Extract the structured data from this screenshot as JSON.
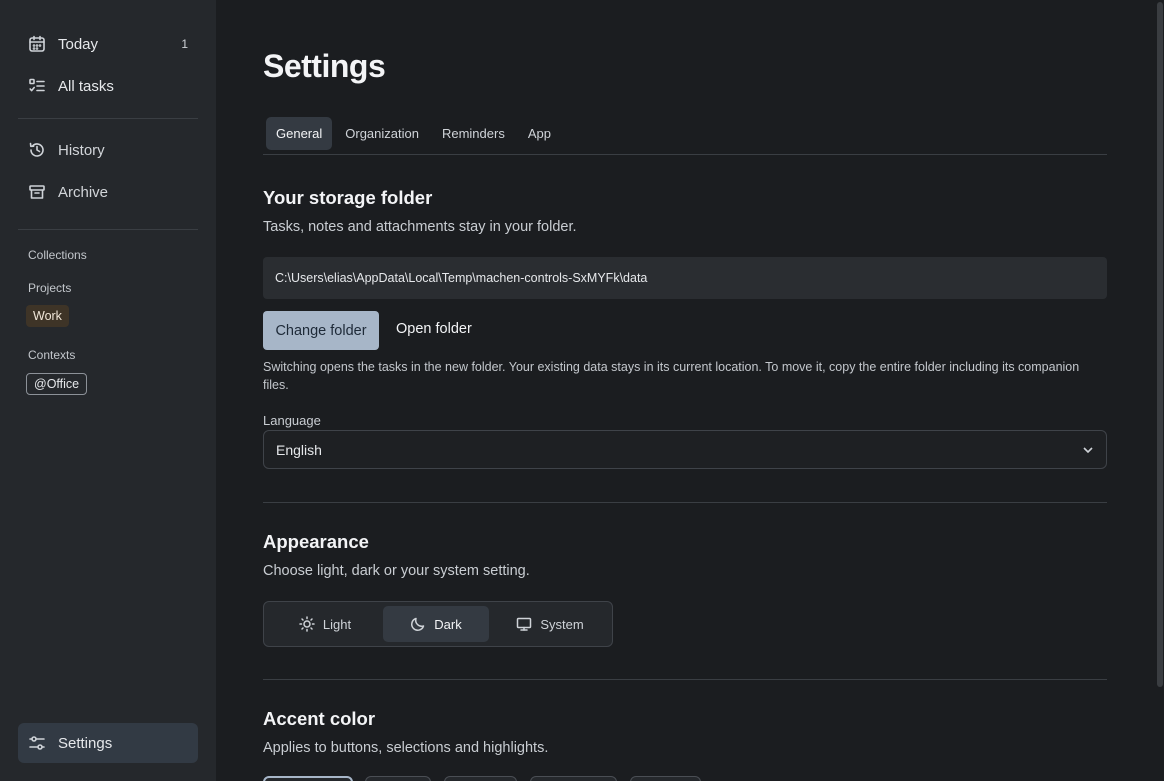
{
  "sidebar": {
    "today": {
      "label": "Today",
      "count": "1"
    },
    "all_tasks": {
      "label": "All tasks"
    },
    "history": {
      "label": "History"
    },
    "archive": {
      "label": "Archive"
    },
    "collections_label": "Collections",
    "projects_label": "Projects",
    "project_tag": "Work",
    "contexts_label": "Contexts",
    "context_tag": "@Office",
    "settings": {
      "label": "Settings"
    }
  },
  "page": {
    "title": "Settings",
    "tabs": [
      {
        "label": "General",
        "active": true
      },
      {
        "label": "Organization",
        "active": false
      },
      {
        "label": "Reminders",
        "active": false
      },
      {
        "label": "App",
        "active": false
      }
    ]
  },
  "storage": {
    "heading": "Your storage folder",
    "description": "Tasks, notes and attachments stay in your folder.",
    "path": "C:\\Users\\elias\\AppData\\Local\\Temp\\machen-controls-SxMYFk\\data",
    "change_button": "Change folder",
    "open_button": "Open folder",
    "note": "Switching opens the tasks in the new folder. Your existing data stays in its current location. To move it, copy the entire folder including its companion files."
  },
  "language": {
    "label": "Language",
    "value": "English"
  },
  "appearance": {
    "heading": "Appearance",
    "description": "Choose light, dark or your system setting.",
    "options": [
      {
        "label": "Light",
        "icon": "sun-icon",
        "active": false
      },
      {
        "label": "Dark",
        "icon": "moon-icon",
        "active": true
      },
      {
        "label": "System",
        "icon": "monitor-icon",
        "active": false
      }
    ]
  },
  "accent": {
    "heading": "Accent color",
    "description": "Applies to buttons, selections and highlights.",
    "accent_hex": "#a7b6c8"
  }
}
